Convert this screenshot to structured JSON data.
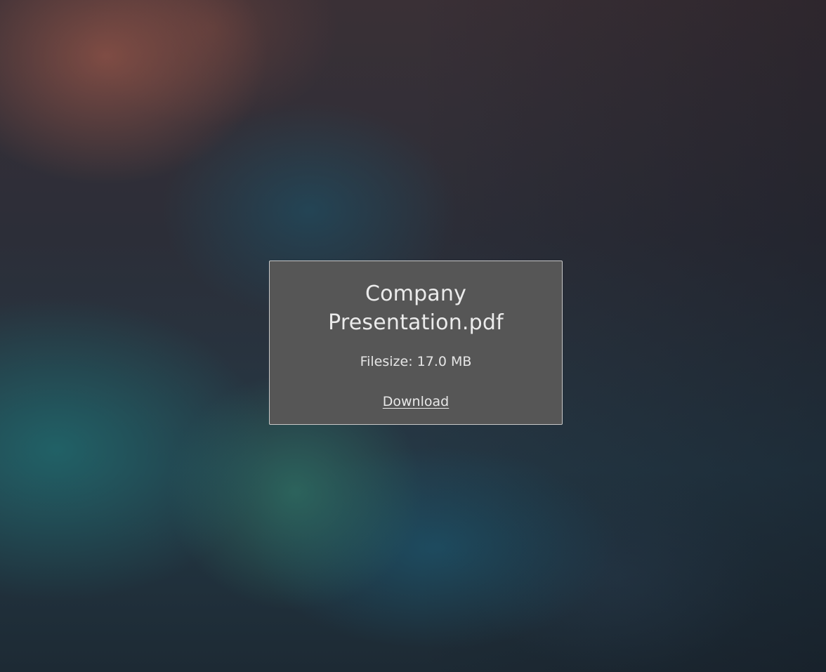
{
  "file": {
    "name": "Company Presentation.pdf",
    "filesize_text": "Filesize: 17.0 MB",
    "download_label": "Download"
  },
  "colors": {
    "card_background": "#565656",
    "card_border": "#c8c8c8",
    "text": "#ebebeb"
  }
}
